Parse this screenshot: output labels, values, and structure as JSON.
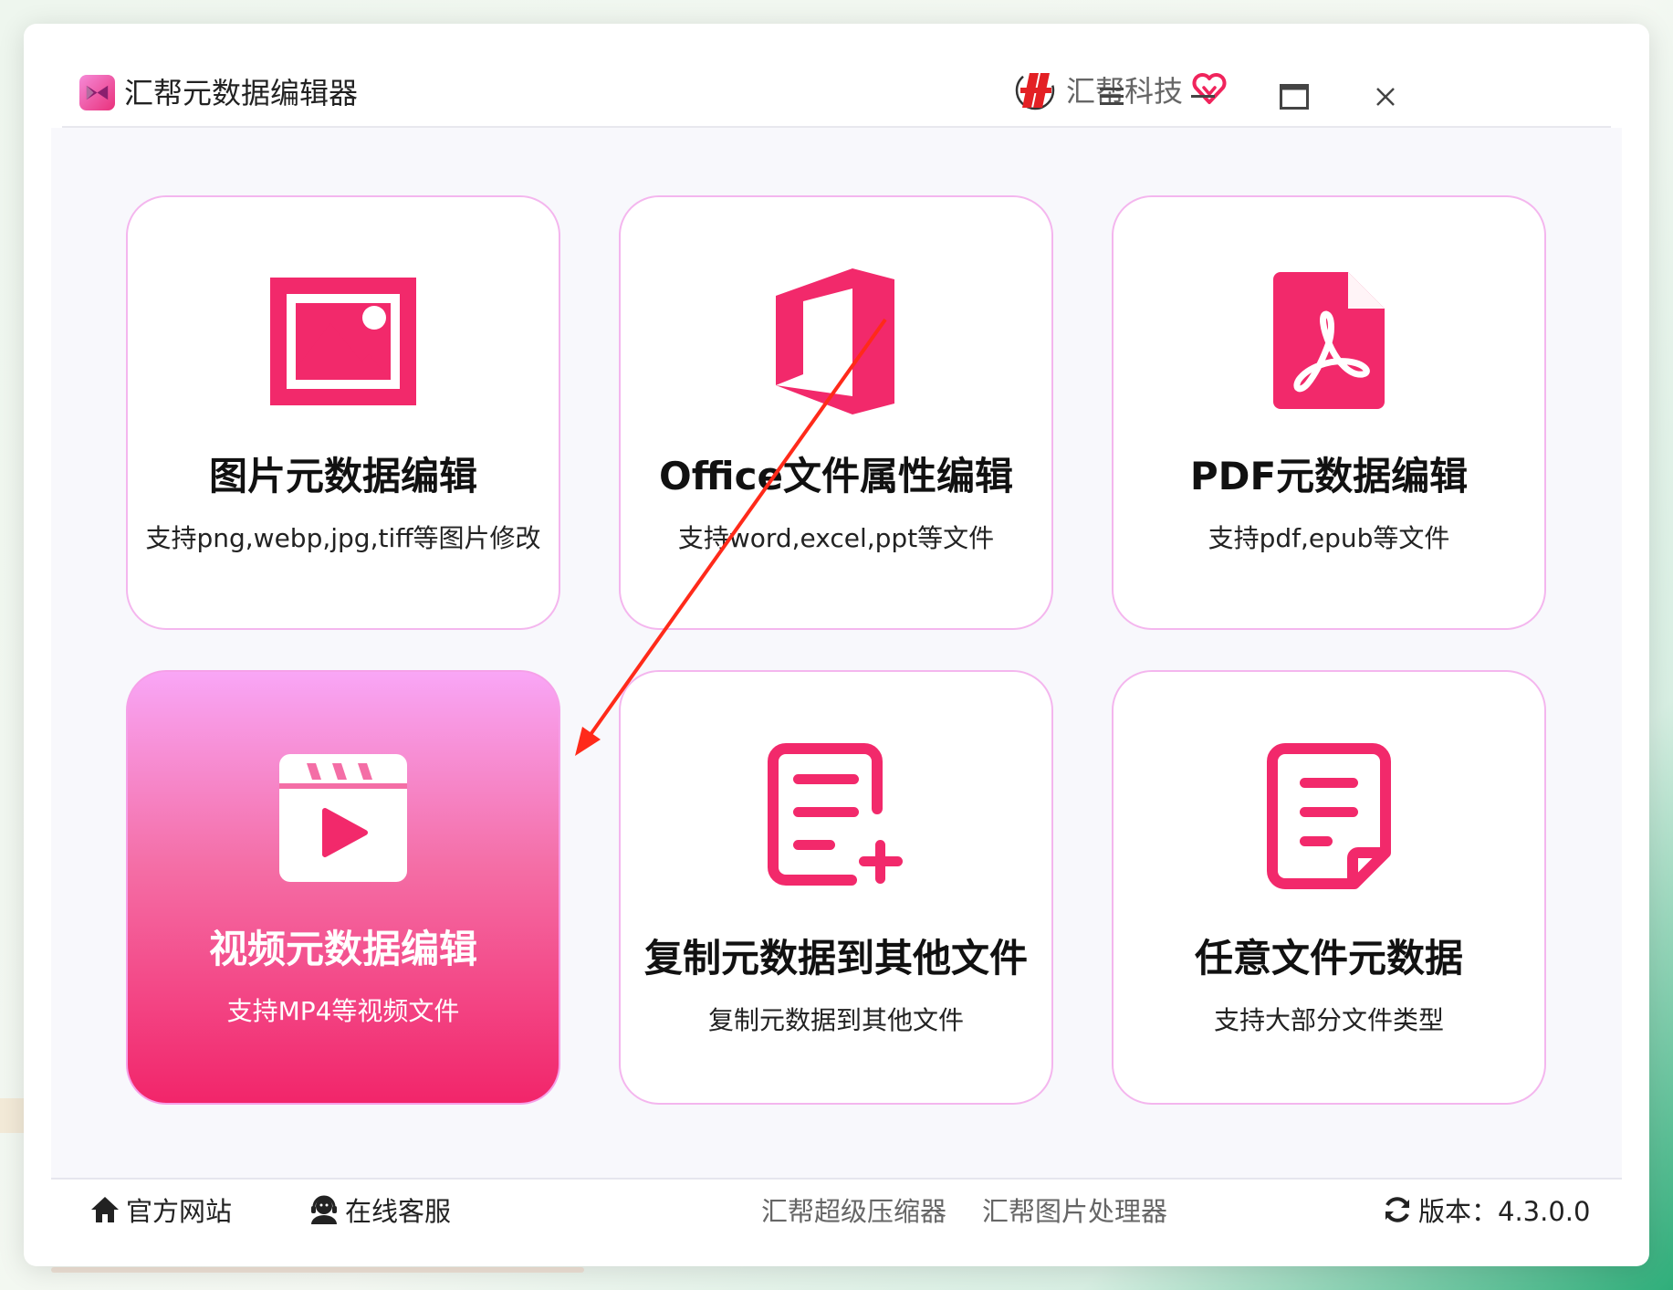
{
  "window": {
    "title": "汇帮元数据编辑器",
    "brand": "汇帮科技",
    "controls": {
      "menu": "menu-icon",
      "minimize": "minimize-icon",
      "maximize": "maximize-icon",
      "close": "close-icon"
    }
  },
  "cards": [
    {
      "title": "图片元数据编辑",
      "desc": "支持png,webp,jpg,tiff等图片修改",
      "icon": "image-icon",
      "active": false
    },
    {
      "title": "Office文件属性编辑",
      "desc": "支持word,excel,ppt等文件",
      "icon": "office-icon",
      "active": false
    },
    {
      "title": "PDF元数据编辑",
      "desc": "支持pdf,epub等文件",
      "icon": "pdf-icon",
      "active": false
    },
    {
      "title": "视频元数据编辑",
      "desc": "支持MP4等视频文件",
      "icon": "video-icon",
      "active": true
    },
    {
      "title": "复制元数据到其他文件",
      "desc": "复制元数据到其他文件",
      "icon": "document-add-icon",
      "active": false
    },
    {
      "title": "任意文件元数据",
      "desc": "支持大部分文件类型",
      "icon": "file-icon",
      "active": false
    }
  ],
  "footer": {
    "website": "官方网站",
    "support": "在线客服",
    "link1": "汇帮超级压缩器",
    "link2": "汇帮图片处理器",
    "version": "版本：4.3.0.0"
  },
  "colors": {
    "accent": "#f2296b",
    "card_border": "#f4b6ee",
    "active_top": "#f9a6f6",
    "active_bottom": "#f2256a",
    "annotation_arrow": "#ff2a1a"
  }
}
